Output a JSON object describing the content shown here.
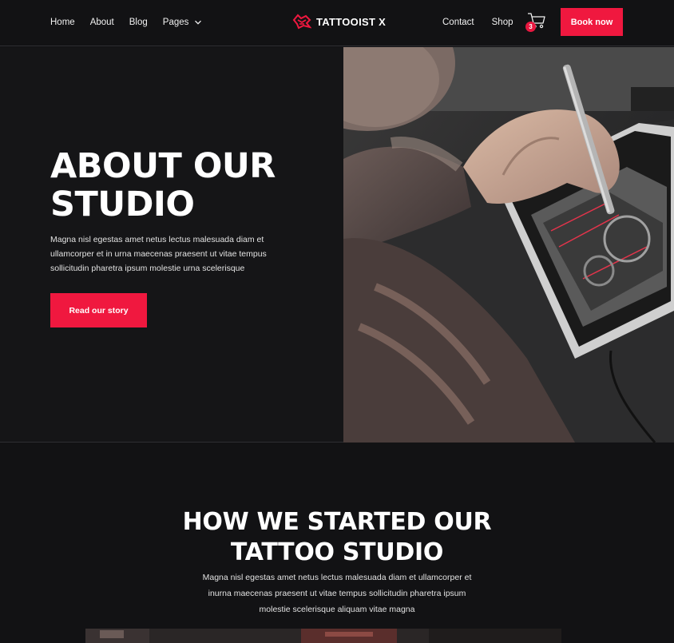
{
  "nav": {
    "links": [
      {
        "label": "Home"
      },
      {
        "label": "About"
      },
      {
        "label": "Blog"
      },
      {
        "label": "Pages"
      }
    ],
    "right_links": [
      {
        "label": "Contact"
      },
      {
        "label": "Shop"
      }
    ],
    "logo_text": "TATTOOIST X",
    "cart_count": "3",
    "book_label": "Book now"
  },
  "hero": {
    "title": "ABOUT OUR STUDIO",
    "text": "Magna nisl egestas amet netus lectus malesuada diam et ullamcorper et in urna maecenas praesent ut vitae tempus sollicitudin pharetra ipsum molestie urna scelerisque",
    "button_label": "Read our story"
  },
  "section2": {
    "title": "HOW WE STARTED OUR TATTOO STUDIO",
    "text": "Magna nisl egestas amet netus lectus malesuada diam et ullamcorper et inurna maecenas praesent ut vitae tempus sollicitudin pharetra ipsum molestie scelerisque aliquam vitae magna"
  },
  "colors": {
    "accent": "#f0183f",
    "background": "#121214",
    "hero_background": "#151517"
  },
  "icons": {
    "logo": "tattoo-machine-icon",
    "pages_dropdown": "chevron-down-icon",
    "cart": "shopping-cart-icon"
  }
}
